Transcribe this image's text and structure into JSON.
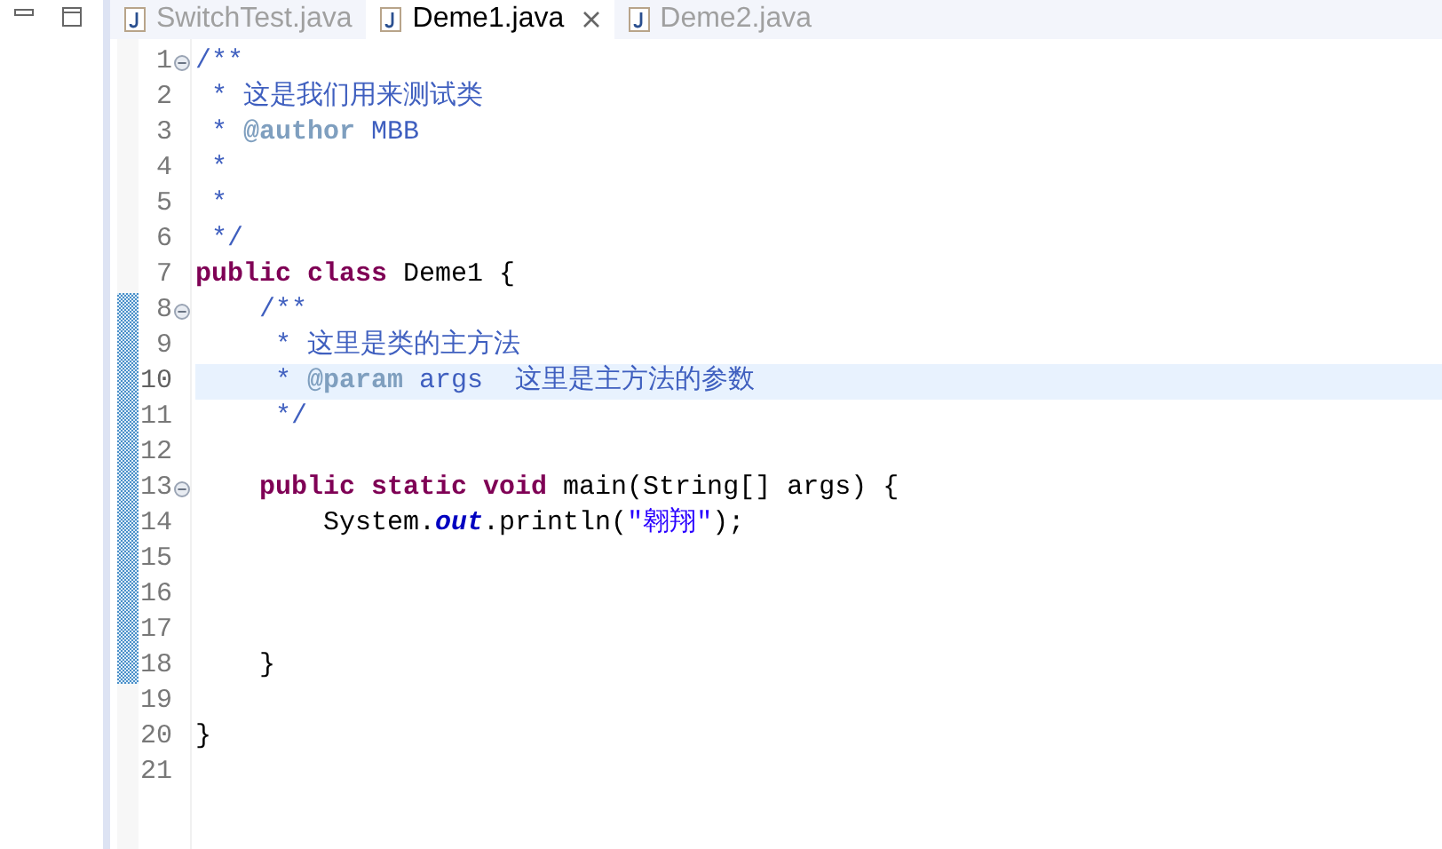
{
  "tabs": [
    {
      "label": "SwitchTest.java",
      "selected": false,
      "closable": false
    },
    {
      "label": "Deme1.java",
      "selected": true,
      "closable": true
    },
    {
      "label": "Deme2.java",
      "selected": false,
      "closable": false
    }
  ],
  "lines": [
    {
      "number": "1",
      "fold": true,
      "changed": false,
      "current": false,
      "tokens": [
        {
          "kind": "comment",
          "text": "/**"
        }
      ]
    },
    {
      "number": "2",
      "fold": false,
      "changed": false,
      "current": false,
      "tokens": [
        {
          "kind": "comment",
          "text": " * 这是我们用来测试类"
        }
      ]
    },
    {
      "number": "3",
      "fold": false,
      "changed": false,
      "current": false,
      "tokens": [
        {
          "kind": "comment",
          "text": " * "
        },
        {
          "kind": "tag",
          "text": "@author"
        },
        {
          "kind": "comment",
          "text": " MBB"
        }
      ]
    },
    {
      "number": "4",
      "fold": false,
      "changed": false,
      "current": false,
      "tokens": [
        {
          "kind": "comment",
          "text": " *"
        }
      ]
    },
    {
      "number": "5",
      "fold": false,
      "changed": false,
      "current": false,
      "tokens": [
        {
          "kind": "comment",
          "text": " *"
        }
      ]
    },
    {
      "number": "6",
      "fold": false,
      "changed": false,
      "current": false,
      "tokens": [
        {
          "kind": "comment",
          "text": " */"
        }
      ]
    },
    {
      "number": "7",
      "fold": false,
      "changed": false,
      "current": false,
      "tokens": [
        {
          "kind": "keyword",
          "text": "public class"
        },
        {
          "kind": "plain",
          "text": " Deme1 {"
        }
      ]
    },
    {
      "number": "8",
      "fold": true,
      "changed": true,
      "current": false,
      "tokens": [
        {
          "kind": "comment",
          "text": "    /**"
        }
      ]
    },
    {
      "number": "9",
      "fold": false,
      "changed": true,
      "current": false,
      "tokens": [
        {
          "kind": "comment",
          "text": "     * 这里是类的主方法"
        }
      ]
    },
    {
      "number": "10",
      "fold": false,
      "changed": true,
      "current": true,
      "tokens": [
        {
          "kind": "comment",
          "text": "     * "
        },
        {
          "kind": "tag",
          "text": "@param"
        },
        {
          "kind": "comment",
          "text": " args  这里是主方法的参数"
        }
      ]
    },
    {
      "number": "11",
      "fold": false,
      "changed": true,
      "current": false,
      "tokens": [
        {
          "kind": "comment",
          "text": "     */"
        }
      ]
    },
    {
      "number": "12",
      "fold": false,
      "changed": true,
      "current": false
    },
    {
      "number": "13",
      "fold": true,
      "changed": true,
      "current": false,
      "tokens": [
        {
          "kind": "keyword",
          "text": "    public static void"
        },
        {
          "kind": "plain",
          "text": " main(String[] args) {"
        }
      ]
    },
    {
      "number": "14",
      "fold": false,
      "changed": true,
      "current": false,
      "tokens": [
        {
          "kind": "plain",
          "text": "        System."
        },
        {
          "kind": "field",
          "text": "out"
        },
        {
          "kind": "plain",
          "text": ".println("
        },
        {
          "kind": "string",
          "text": "\"翱翔\""
        },
        {
          "kind": "plain",
          "text": ");"
        }
      ]
    },
    {
      "number": "15",
      "fold": false,
      "changed": true,
      "current": false
    },
    {
      "number": "16",
      "fold": false,
      "changed": true,
      "current": false
    },
    {
      "number": "17",
      "fold": false,
      "changed": true,
      "current": false
    },
    {
      "number": "18",
      "fold": false,
      "changed": true,
      "current": false,
      "tokens": [
        {
          "kind": "plain",
          "text": "    }"
        }
      ]
    },
    {
      "number": "19",
      "fold": false,
      "changed": false,
      "current": false
    },
    {
      "number": "20",
      "fold": false,
      "changed": false,
      "current": false,
      "tokens": [
        {
          "kind": "plain",
          "text": "}"
        }
      ]
    },
    {
      "number": "21",
      "fold": false,
      "changed": false,
      "current": false
    }
  ]
}
